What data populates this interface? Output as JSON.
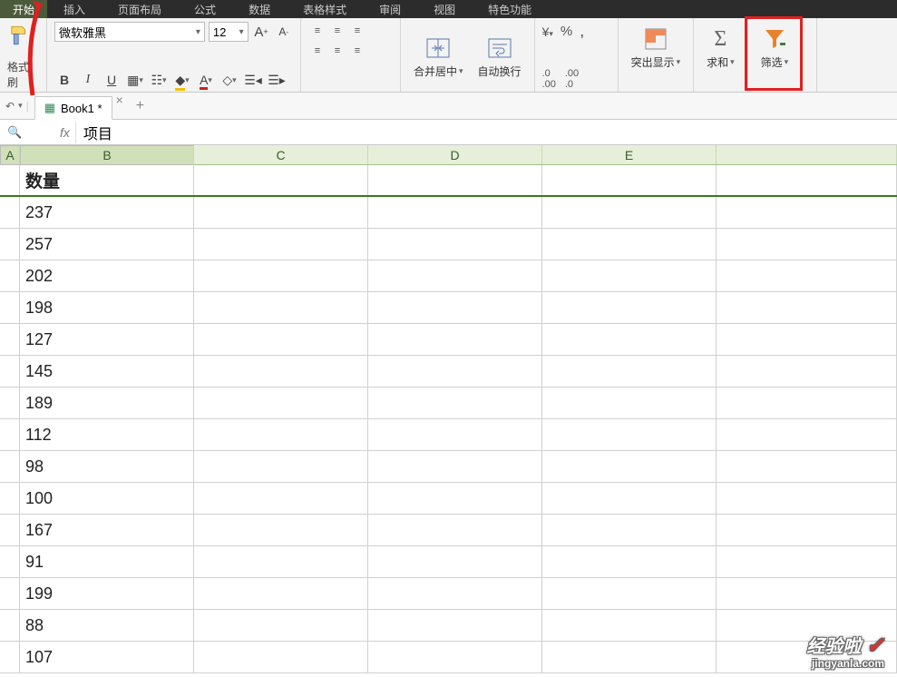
{
  "menu": {
    "items": [
      "开始",
      "插入",
      "页面布局",
      "公式",
      "数据",
      "表格样式",
      "审阅",
      "视图",
      "特色功能"
    ]
  },
  "ribbon": {
    "painter_label": "格式刷",
    "font_name": "微软雅黑",
    "font_size": "12",
    "merge_label": "合并居中",
    "wrap_label": "自动换行",
    "percent": "%",
    "highlight_label": "突出显示",
    "sum_label": "求和",
    "filter_label": "筛选"
  },
  "doctab": {
    "name": "Book1 *"
  },
  "formula": {
    "value": "项目"
  },
  "columns": {
    "A": "A",
    "B": "B",
    "C": "C",
    "D": "D",
    "E": "E"
  },
  "header": {
    "B": "数量"
  },
  "data": {
    "rows": [
      "237",
      "257",
      "202",
      "198",
      "127",
      "145",
      "189",
      "112",
      "98",
      "100",
      "167",
      "91",
      "199",
      "88",
      "107"
    ]
  },
  "watermark": {
    "line1": "经验啦",
    "check": "✓",
    "line2": "jingyanla.com"
  }
}
